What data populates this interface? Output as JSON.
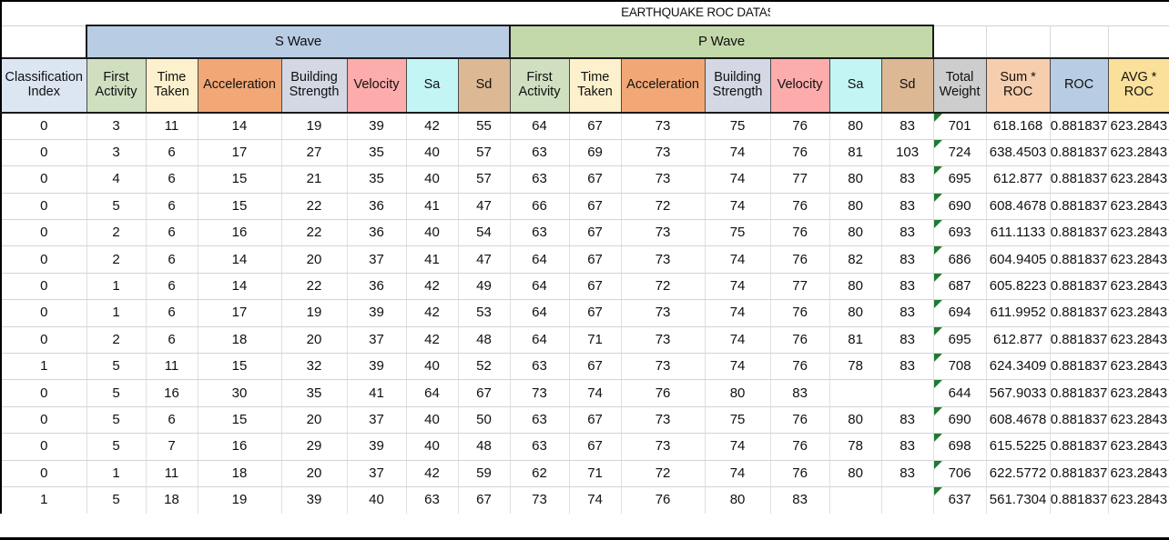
{
  "document": {
    "title": "EARTHQUAKE ROC DATASET",
    "type": "spreadsheet"
  },
  "groups": [
    {
      "label": "S Wave",
      "color": "#b8cce4",
      "span": 7
    },
    {
      "label": "P Wave",
      "color": "#c3d8a8",
      "span": 7
    }
  ],
  "columns": [
    {
      "key": "classification_index",
      "line1": "Classification",
      "line2": "Index",
      "color": "#dce6f2"
    },
    {
      "key": "s_first_activity",
      "line1": "First",
      "line2": "Activity",
      "color": "#cfdfc0"
    },
    {
      "key": "s_time_taken",
      "line1": "Time",
      "line2": "Taken",
      "color": "#fdf1cd"
    },
    {
      "key": "s_acceleration",
      "line1": "Acceleration",
      "line2": "",
      "color": "#f2a776"
    },
    {
      "key": "s_building_strength",
      "line1": "Building",
      "line2": "Strength",
      "color": "#d4d8e4"
    },
    {
      "key": "s_velocity",
      "line1": "Velocity",
      "line2": "",
      "color": "#fdacac"
    },
    {
      "key": "s_sa",
      "line1": "Sa",
      "line2": "",
      "color": "#c4f5f5"
    },
    {
      "key": "s_sd",
      "line1": "Sd",
      "line2": "",
      "color": "#ddb894"
    },
    {
      "key": "p_first_activity",
      "line1": "First",
      "line2": "Activity",
      "color": "#cfdfc0"
    },
    {
      "key": "p_time_taken",
      "line1": "Time",
      "line2": "Taken",
      "color": "#fdf1cd"
    },
    {
      "key": "p_acceleration",
      "line1": "Acceleration",
      "line2": "",
      "color": "#f2a776"
    },
    {
      "key": "p_building_strength",
      "line1": "Building",
      "line2": "Strength",
      "color": "#d4d8e4"
    },
    {
      "key": "p_velocity",
      "line1": "Velocity",
      "line2": "",
      "color": "#fdacac"
    },
    {
      "key": "p_sa",
      "line1": "Sa",
      "line2": "",
      "color": "#c4f5f5"
    },
    {
      "key": "p_sd",
      "line1": "Sd",
      "line2": "",
      "color": "#ddb894"
    },
    {
      "key": "total_weight",
      "line1": "Total",
      "line2": "Weight",
      "color": "#cdcdcd"
    },
    {
      "key": "sum_roc",
      "line1": "Sum *",
      "line2": "ROC",
      "color": "#f7cead"
    },
    {
      "key": "roc",
      "line1": "ROC",
      "line2": "",
      "color": "#b8cce4"
    },
    {
      "key": "avg_roc",
      "line1": "AVG *",
      "line2": "ROC",
      "color": "#fae09a"
    }
  ],
  "rows": [
    {
      "classification_index": "0",
      "s_first_activity": "3",
      "s_time_taken": "11",
      "s_acceleration": "14",
      "s_building_strength": "19",
      "s_velocity": "39",
      "s_sa": "42",
      "s_sd": "55",
      "p_first_activity": "64",
      "p_time_taken": "67",
      "p_acceleration": "73",
      "p_building_strength": "75",
      "p_velocity": "76",
      "p_sa": "80",
      "p_sd": "83",
      "total_weight": "701",
      "sum_roc": "618.168",
      "roc": "0.881837",
      "avg_roc": "623.2843",
      "has_comment": true
    },
    {
      "classification_index": "0",
      "s_first_activity": "3",
      "s_time_taken": "6",
      "s_acceleration": "17",
      "s_building_strength": "27",
      "s_velocity": "35",
      "s_sa": "40",
      "s_sd": "57",
      "p_first_activity": "63",
      "p_time_taken": "69",
      "p_acceleration": "73",
      "p_building_strength": "74",
      "p_velocity": "76",
      "p_sa": "81",
      "p_sd": "103",
      "total_weight": "724",
      "sum_roc": "638.4503",
      "roc": "0.881837",
      "avg_roc": "623.2843",
      "has_comment": true
    },
    {
      "classification_index": "0",
      "s_first_activity": "4",
      "s_time_taken": "6",
      "s_acceleration": "15",
      "s_building_strength": "21",
      "s_velocity": "35",
      "s_sa": "40",
      "s_sd": "57",
      "p_first_activity": "63",
      "p_time_taken": "67",
      "p_acceleration": "73",
      "p_building_strength": "74",
      "p_velocity": "77",
      "p_sa": "80",
      "p_sd": "83",
      "total_weight": "695",
      "sum_roc": "612.877",
      "roc": "0.881837",
      "avg_roc": "623.2843",
      "has_comment": true
    },
    {
      "classification_index": "0",
      "s_first_activity": "5",
      "s_time_taken": "6",
      "s_acceleration": "15",
      "s_building_strength": "22",
      "s_velocity": "36",
      "s_sa": "41",
      "s_sd": "47",
      "p_first_activity": "66",
      "p_time_taken": "67",
      "p_acceleration": "72",
      "p_building_strength": "74",
      "p_velocity": "76",
      "p_sa": "80",
      "p_sd": "83",
      "total_weight": "690",
      "sum_roc": "608.4678",
      "roc": "0.881837",
      "avg_roc": "623.2843",
      "has_comment": true
    },
    {
      "classification_index": "0",
      "s_first_activity": "2",
      "s_time_taken": "6",
      "s_acceleration": "16",
      "s_building_strength": "22",
      "s_velocity": "36",
      "s_sa": "40",
      "s_sd": "54",
      "p_first_activity": "63",
      "p_time_taken": "67",
      "p_acceleration": "73",
      "p_building_strength": "75",
      "p_velocity": "76",
      "p_sa": "80",
      "p_sd": "83",
      "total_weight": "693",
      "sum_roc": "611.1133",
      "roc": "0.881837",
      "avg_roc": "623.2843",
      "has_comment": true
    },
    {
      "classification_index": "0",
      "s_first_activity": "2",
      "s_time_taken": "6",
      "s_acceleration": "14",
      "s_building_strength": "20",
      "s_velocity": "37",
      "s_sa": "41",
      "s_sd": "47",
      "p_first_activity": "64",
      "p_time_taken": "67",
      "p_acceleration": "73",
      "p_building_strength": "74",
      "p_velocity": "76",
      "p_sa": "82",
      "p_sd": "83",
      "total_weight": "686",
      "sum_roc": "604.9405",
      "roc": "0.881837",
      "avg_roc": "623.2843",
      "has_comment": true
    },
    {
      "classification_index": "0",
      "s_first_activity": "1",
      "s_time_taken": "6",
      "s_acceleration": "14",
      "s_building_strength": "22",
      "s_velocity": "36",
      "s_sa": "42",
      "s_sd": "49",
      "p_first_activity": "64",
      "p_time_taken": "67",
      "p_acceleration": "72",
      "p_building_strength": "74",
      "p_velocity": "77",
      "p_sa": "80",
      "p_sd": "83",
      "total_weight": "687",
      "sum_roc": "605.8223",
      "roc": "0.881837",
      "avg_roc": "623.2843",
      "has_comment": true
    },
    {
      "classification_index": "0",
      "s_first_activity": "1",
      "s_time_taken": "6",
      "s_acceleration": "17",
      "s_building_strength": "19",
      "s_velocity": "39",
      "s_sa": "42",
      "s_sd": "53",
      "p_first_activity": "64",
      "p_time_taken": "67",
      "p_acceleration": "73",
      "p_building_strength": "74",
      "p_velocity": "76",
      "p_sa": "80",
      "p_sd": "83",
      "total_weight": "694",
      "sum_roc": "611.9952",
      "roc": "0.881837",
      "avg_roc": "623.2843",
      "has_comment": true
    },
    {
      "classification_index": "0",
      "s_first_activity": "2",
      "s_time_taken": "6",
      "s_acceleration": "18",
      "s_building_strength": "20",
      "s_velocity": "37",
      "s_sa": "42",
      "s_sd": "48",
      "p_first_activity": "64",
      "p_time_taken": "71",
      "p_acceleration": "73",
      "p_building_strength": "74",
      "p_velocity": "76",
      "p_sa": "81",
      "p_sd": "83",
      "total_weight": "695",
      "sum_roc": "612.877",
      "roc": "0.881837",
      "avg_roc": "623.2843",
      "has_comment": true
    },
    {
      "classification_index": "1",
      "s_first_activity": "5",
      "s_time_taken": "11",
      "s_acceleration": "15",
      "s_building_strength": "32",
      "s_velocity": "39",
      "s_sa": "40",
      "s_sd": "52",
      "p_first_activity": "63",
      "p_time_taken": "67",
      "p_acceleration": "73",
      "p_building_strength": "74",
      "p_velocity": "76",
      "p_sa": "78",
      "p_sd": "83",
      "total_weight": "708",
      "sum_roc": "624.3409",
      "roc": "0.881837",
      "avg_roc": "623.2843",
      "has_comment": true
    },
    {
      "classification_index": "0",
      "s_first_activity": "5",
      "s_time_taken": "16",
      "s_acceleration": "30",
      "s_building_strength": "35",
      "s_velocity": "41",
      "s_sa": "64",
      "s_sd": "67",
      "p_first_activity": "73",
      "p_time_taken": "74",
      "p_acceleration": "76",
      "p_building_strength": "80",
      "p_velocity": "83",
      "p_sa": "",
      "p_sd": "",
      "total_weight": "644",
      "sum_roc": "567.9033",
      "roc": "0.881837",
      "avg_roc": "623.2843",
      "has_comment": true
    },
    {
      "classification_index": "0",
      "s_first_activity": "5",
      "s_time_taken": "6",
      "s_acceleration": "15",
      "s_building_strength": "20",
      "s_velocity": "37",
      "s_sa": "40",
      "s_sd": "50",
      "p_first_activity": "63",
      "p_time_taken": "67",
      "p_acceleration": "73",
      "p_building_strength": "75",
      "p_velocity": "76",
      "p_sa": "80",
      "p_sd": "83",
      "total_weight": "690",
      "sum_roc": "608.4678",
      "roc": "0.881837",
      "avg_roc": "623.2843",
      "has_comment": true
    },
    {
      "classification_index": "0",
      "s_first_activity": "5",
      "s_time_taken": "7",
      "s_acceleration": "16",
      "s_building_strength": "29",
      "s_velocity": "39",
      "s_sa": "40",
      "s_sd": "48",
      "p_first_activity": "63",
      "p_time_taken": "67",
      "p_acceleration": "73",
      "p_building_strength": "74",
      "p_velocity": "76",
      "p_sa": "78",
      "p_sd": "83",
      "total_weight": "698",
      "sum_roc": "615.5225",
      "roc": "0.881837",
      "avg_roc": "623.2843",
      "has_comment": true
    },
    {
      "classification_index": "0",
      "s_first_activity": "1",
      "s_time_taken": "11",
      "s_acceleration": "18",
      "s_building_strength": "20",
      "s_velocity": "37",
      "s_sa": "42",
      "s_sd": "59",
      "p_first_activity": "62",
      "p_time_taken": "71",
      "p_acceleration": "72",
      "p_building_strength": "74",
      "p_velocity": "76",
      "p_sa": "80",
      "p_sd": "83",
      "total_weight": "706",
      "sum_roc": "622.5772",
      "roc": "0.881837",
      "avg_roc": "623.2843",
      "has_comment": true
    },
    {
      "classification_index": "1",
      "s_first_activity": "5",
      "s_time_taken": "18",
      "s_acceleration": "19",
      "s_building_strength": "39",
      "s_velocity": "40",
      "s_sa": "63",
      "s_sd": "67",
      "p_first_activity": "73",
      "p_time_taken": "74",
      "p_acceleration": "76",
      "p_building_strength": "80",
      "p_velocity": "83",
      "p_sa": "",
      "p_sd": "",
      "total_weight": "637",
      "sum_roc": "561.7304",
      "roc": "0.881837",
      "avg_roc": "623.2843",
      "has_comment": true
    }
  ]
}
